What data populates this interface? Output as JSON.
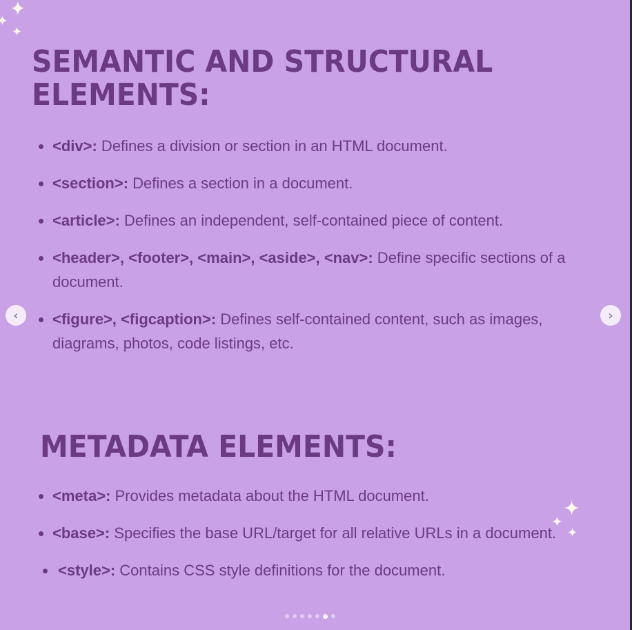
{
  "heading1": "SEMANTIC AND STRUCTURAL ELEMENTS:",
  "list1": [
    {
      "tag": "<div>:",
      "text": " Defines a division or section in an HTML document."
    },
    {
      "tag": "<section>:",
      "text": " Defines a section in a document."
    },
    {
      "tag": "<article>:",
      "text": " Defines an independent, self-contained piece of content."
    },
    {
      "tag": "<header>, <footer>, <main>, <aside>, <nav>:",
      "text": " Define specific sections of a document."
    },
    {
      "tag": "<figure>, <figcaption>:",
      "text": " Defines self-contained content, such as images, diagrams, photos, code listings, etc."
    }
  ],
  "heading2": "METADATA ELEMENTS:",
  "list2": [
    {
      "tag": "<meta>:",
      "text": " Provides metadata about the HTML document."
    },
    {
      "tag": "<base>:",
      "text": " Specifies the base URL/target for all relative URLs in a document."
    },
    {
      "tag": "<style>:",
      "text": " Contains CSS style definitions for the document."
    }
  ],
  "carousel": {
    "prev_icon": "chevron-left-icon",
    "next_icon": "chevron-right-icon",
    "total_slides": 7,
    "current_slide": 6
  },
  "colors": {
    "background": "#c9a1e7",
    "text": "#6b3a82",
    "sparkle": "#fbf8ec"
  }
}
